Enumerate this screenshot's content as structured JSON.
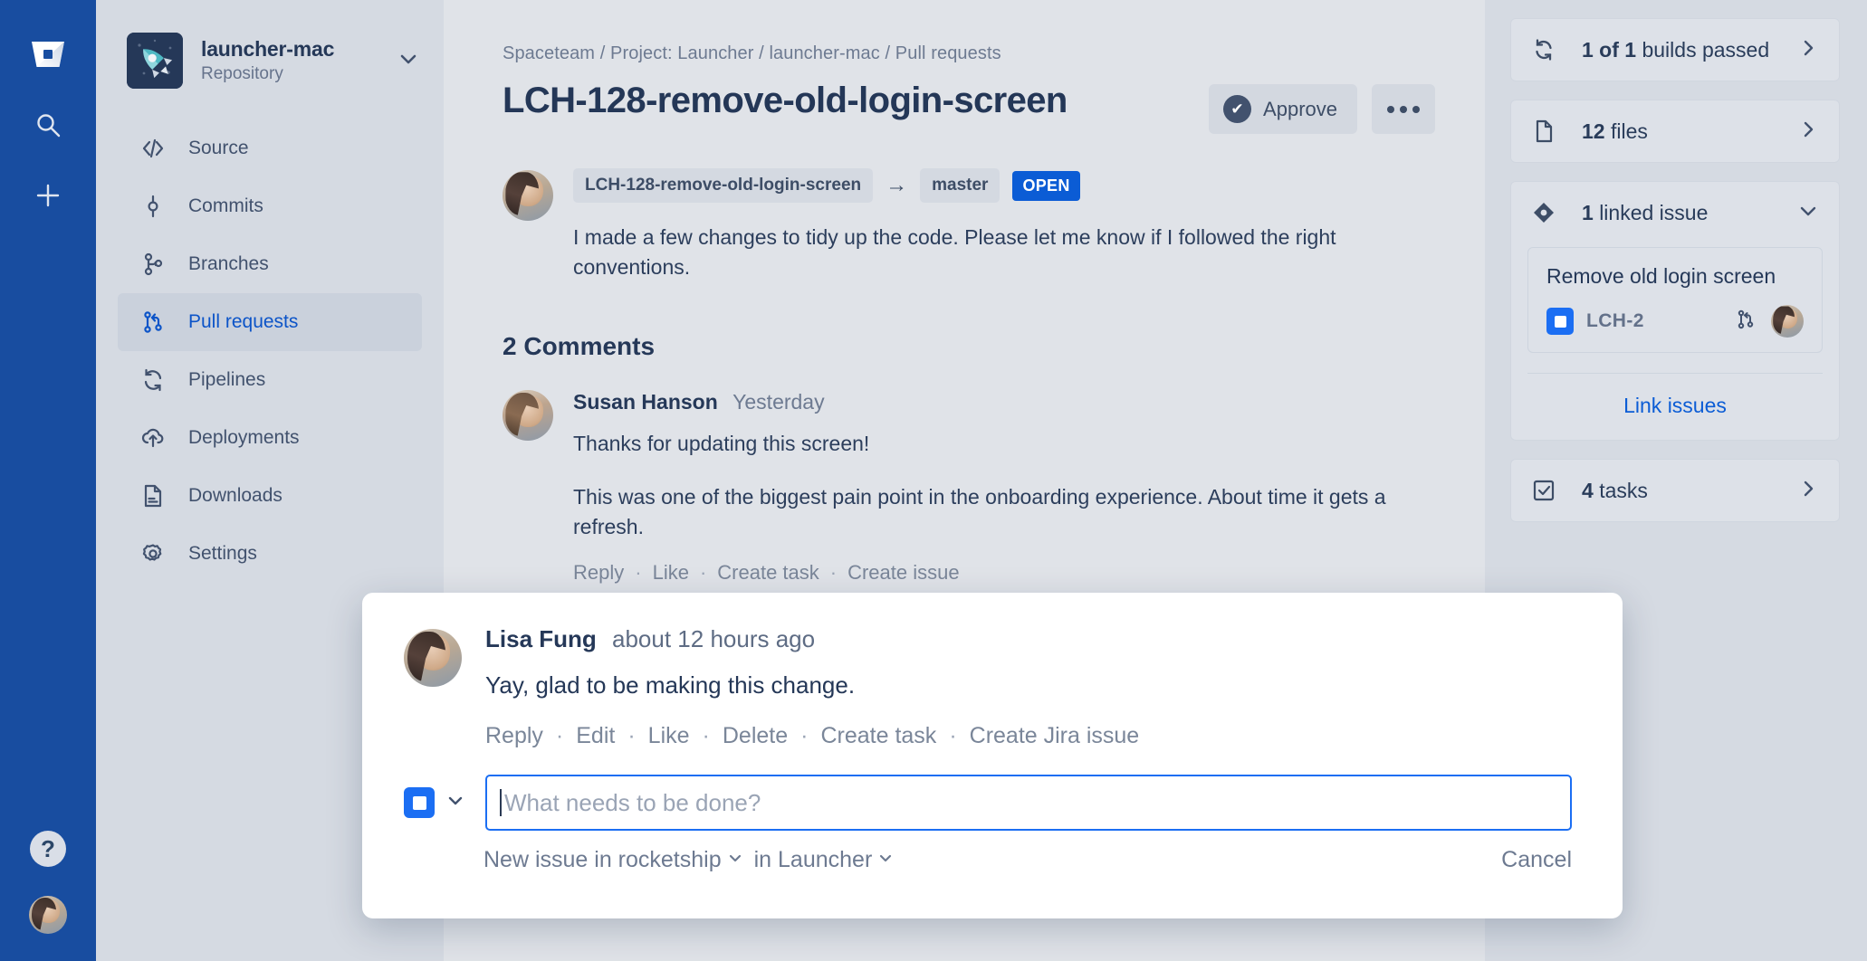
{
  "rail": {
    "logo_icon": "bitbucket-logo",
    "search_icon": "search-icon",
    "create_icon": "plus-icon",
    "help_label": "?",
    "avatar_label": "user-avatar"
  },
  "sidebar": {
    "repo_name": "launcher-mac",
    "repo_type": "Repository",
    "repo_switcher_icon": "chevron-down-icon",
    "items": [
      {
        "label": "Source",
        "icon": "code-icon",
        "active": false
      },
      {
        "label": "Commits",
        "icon": "commit-icon",
        "active": false
      },
      {
        "label": "Branches",
        "icon": "branch-icon",
        "active": false
      },
      {
        "label": "Pull requests",
        "icon": "pull-request-icon",
        "active": true
      },
      {
        "label": "Pipelines",
        "icon": "pipelines-icon",
        "active": false
      },
      {
        "label": "Deployments",
        "icon": "deployments-icon",
        "active": false
      },
      {
        "label": "Downloads",
        "icon": "downloads-icon",
        "active": false
      },
      {
        "label": "Settings",
        "icon": "gear-icon",
        "active": false
      }
    ]
  },
  "main": {
    "breadcrumb": "Spaceteam / Project: Launcher / launcher-mac / Pull requests",
    "pr_title": "LCH-128-remove-old-login-screen",
    "approve_label": "Approve",
    "more_label": "•••",
    "source_branch": "LCH-128-remove-old-login-screen",
    "branch_arrow": "→",
    "target_branch": "master",
    "status_badge": "OPEN",
    "pr_description": "I made a few changes to tidy up the code. Please let me know if I followed the right conventions.",
    "comments_heading": "2 Comments",
    "comments": [
      {
        "author": "Susan Hanson",
        "time": "Yesterday",
        "paragraph_1": "Thanks for updating this screen!",
        "paragraph_2": "This was one of the biggest pain point in the onboarding experience. About time it gets a refresh.",
        "actions": [
          "Reply",
          "Like",
          "Create task",
          "Create issue"
        ]
      }
    ]
  },
  "right_panel": {
    "builds": {
      "count_prefix": "1 of 1",
      "label": "builds passed",
      "icon": "pipelines-icon",
      "chevron": "›"
    },
    "files": {
      "count": "12",
      "label": "files",
      "icon": "file-icon",
      "chevron": "›"
    },
    "linked_issues": {
      "count": "1",
      "label": "linked issue",
      "icon": "jira-diamond-icon",
      "chevron": "chevron-down-icon",
      "issue_title": "Remove old login screen",
      "issue_key": "LCH-2",
      "issue_type_icon": "jira-task-icon",
      "branch_icon": "pull-request-icon",
      "link_issues_label": "Link issues"
    },
    "tasks": {
      "count": "4",
      "label": "tasks",
      "icon": "checkbox-icon",
      "chevron": "›"
    }
  },
  "modal": {
    "author": "Lisa Fung",
    "time": "about 12 hours ago",
    "comment_text": "Yay, glad to be making this change.",
    "actions": [
      "Reply",
      "Edit",
      "Like",
      "Delete",
      "Create task",
      "Create Jira issue"
    ],
    "separator": "·",
    "issue_type_icon": "jira-task-icon",
    "type_chevron": "chevron-down-icon",
    "input_placeholder": "What needs to be done?",
    "input_value": "",
    "project_label": "New issue in rocketship",
    "project_chevron": "chevron-down-icon",
    "board_label": "in Launcher",
    "board_chevron": "chevron-down-icon",
    "cancel_label": "Cancel"
  },
  "colors": {
    "rail_blue": "#184da0",
    "accent_blue": "#0b5cd5",
    "focus_blue": "#1b6ef3",
    "text_dark": "#253858",
    "text_muted": "#6d7a91",
    "bg_main": "#e0e3e8",
    "bg_panel": "#d5dae2"
  }
}
